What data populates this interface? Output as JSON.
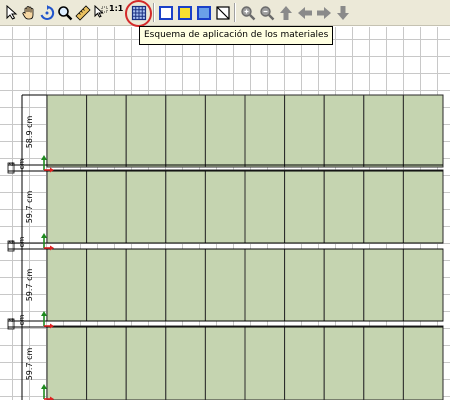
{
  "toolbar": {
    "buttons": [
      {
        "name": "select-arrow-icon"
      },
      {
        "name": "pan-hand-icon"
      },
      {
        "name": "rotate-icon"
      },
      {
        "name": "zoom-magnifier-icon"
      },
      {
        "name": "measure-ruler-icon"
      },
      {
        "name": "select-region-icon"
      },
      {
        "name": "scale-one-to-one-button"
      },
      {
        "name": "material-layout-grid-icon"
      },
      {
        "name": "square-blue-outline-icon"
      },
      {
        "name": "square-yellow-icon"
      },
      {
        "name": "square-blue-fill-icon"
      },
      {
        "name": "square-diagonal-icon"
      },
      {
        "name": "zoom-in-icon"
      },
      {
        "name": "zoom-out-icon"
      },
      {
        "name": "arrow-up-icon"
      },
      {
        "name": "arrow-left-icon"
      },
      {
        "name": "arrow-right-icon"
      },
      {
        "name": "arrow-down-icon"
      }
    ],
    "scale_label": "1:1",
    "tooltip": "Esquema de aplicación de los materiales"
  },
  "plan": {
    "rows": [
      {
        "height_label": "58.9 cm"
      },
      {
        "height_label": "59.7 cm"
      },
      {
        "height_label": "59.7 cm"
      },
      {
        "height_label": "59.7 cm"
      }
    ],
    "gap_label": "4 cm",
    "columns": 10,
    "colors": {
      "panel_fill": "#c5d4b0",
      "panel_line": "#2a2a2a",
      "marker_green": "#1e8a1e",
      "marker_red": "#e02020",
      "highlight": "#d42a2a"
    }
  }
}
